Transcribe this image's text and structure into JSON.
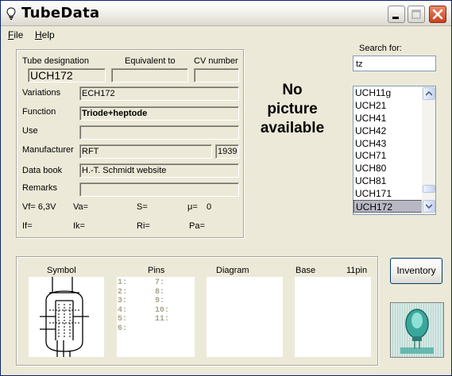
{
  "app": {
    "title": "TubeData"
  },
  "menu": {
    "file_label": "File",
    "file_rest": "ile",
    "file_acc": "F",
    "help_acc": "H",
    "help_rest": "elp"
  },
  "colors": {
    "titlebar_close": "#c8401c",
    "selection": "#b8b8c4",
    "pins_text": "#a8a38a",
    "logo_teal": "#3aa79b"
  },
  "details": {
    "tube_designation_label": "Tube designation",
    "equivalent_label": "Equivalent to",
    "cv_label": "CV number",
    "tube_designation_value": "UCH172",
    "equivalent_value": "",
    "cv_value": "",
    "variations_label": "Variations",
    "variations_value": "ECH172",
    "function_label": "Function",
    "function_value": "Triode+heptode",
    "use_label": "Use",
    "use_value": "",
    "manufacturer_label": "Manufacturer",
    "manufacturer_value": "RFT",
    "year_value": "1939",
    "databook_label": "Data book",
    "databook_value": "H.-T. Schmidt website",
    "remarks_label": "Remarks",
    "remarks_value": "",
    "vf": "Vf= 6,3V",
    "va": "Va=",
    "s": "S=",
    "mu_label": "μ=",
    "mu_value": "0",
    "if": "If=",
    "ik": "Ik=",
    "ri": "Ri=",
    "pa": "Pa="
  },
  "no_picture": {
    "line1": "No",
    "line2": "picture",
    "line3": "available"
  },
  "search": {
    "label": "Search for:",
    "value": "tz",
    "results": [
      "UCH11g",
      "UCH21",
      "UCH41",
      "UCH42",
      "UCH43",
      "UCH71",
      "UCH80",
      "UCH81",
      "UCH171",
      "UCH172"
    ],
    "selected": "UCH172"
  },
  "bottom": {
    "symbol_label": "Symbol",
    "pins_label": "Pins",
    "diagram_label": "Diagram",
    "base_label": "Base",
    "base_value": "11pin",
    "pins_left": [
      "1:",
      "2:",
      "3:",
      "4:",
      "5:",
      "6:"
    ],
    "pins_right": [
      "7:",
      "8:",
      "9:",
      "10:",
      "11:"
    ]
  },
  "buttons": {
    "inventory": "Inventory"
  }
}
